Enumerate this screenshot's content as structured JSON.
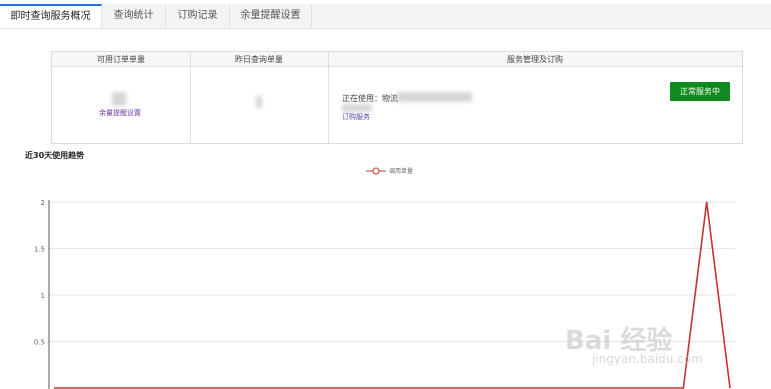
{
  "tabs": [
    {
      "label": "即时查询服务概况",
      "active": true
    },
    {
      "label": "查询统计",
      "active": false
    },
    {
      "label": "订购记录",
      "active": false
    },
    {
      "label": "余量提醒设置",
      "active": false
    }
  ],
  "table": {
    "headers": [
      "可用订单单量",
      "昨日查询单量",
      "服务管理及订购"
    ],
    "remain_link": "余量提醒设置",
    "using_text": "正在使用：物流",
    "order_link": "订购服务",
    "status_button": "正常服务中"
  },
  "chart_title": "近30天使用趋势",
  "chart_data": {
    "type": "line",
    "title": "近30天使用趋势",
    "series": [
      {
        "name": "调用单量",
        "color": "#c23531",
        "values": [
          0,
          0,
          0,
          0,
          0,
          0,
          0,
          0,
          0,
          0,
          0,
          0,
          0,
          0,
          0,
          0,
          0,
          0,
          0,
          0,
          0,
          0,
          0,
          0,
          0,
          0,
          0,
          0,
          2,
          0
        ]
      }
    ],
    "y_ticks": [
      "2",
      "1.5",
      "1",
      "0.5"
    ],
    "ylim": [
      0,
      2
    ],
    "grid": true,
    "legend": "top-center"
  },
  "watermark": {
    "text": "Bai 经验",
    "sub": "jingyan.baidu.com"
  }
}
